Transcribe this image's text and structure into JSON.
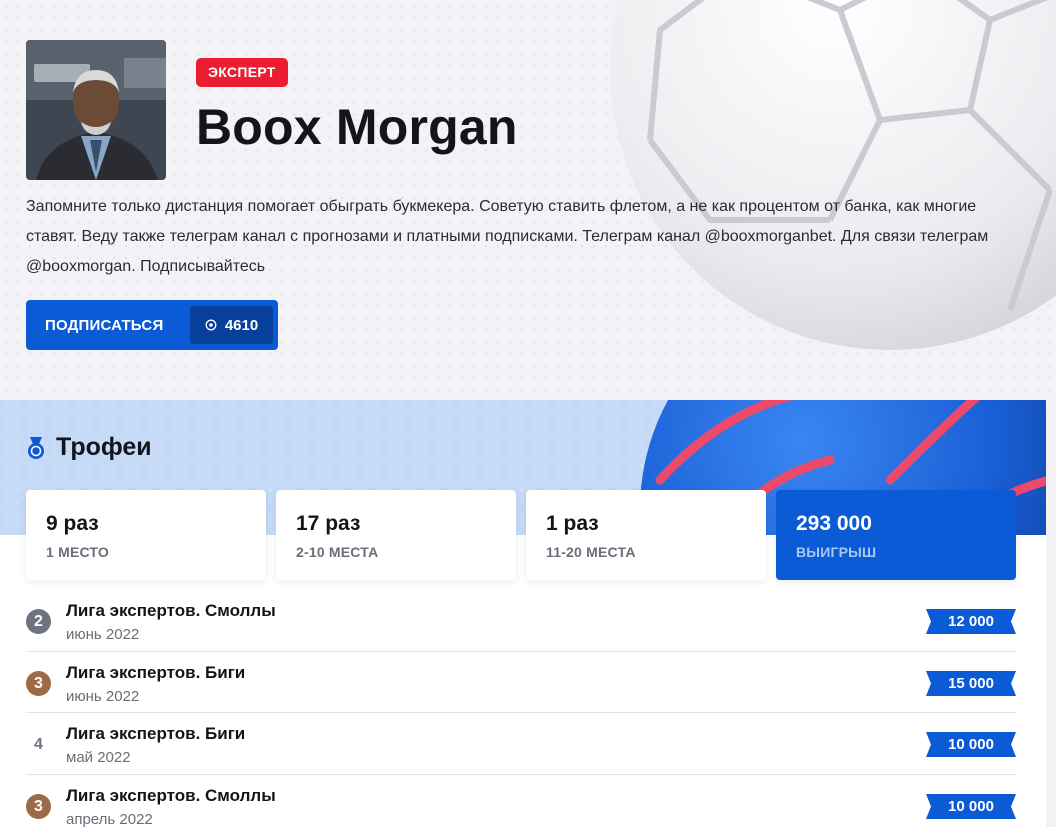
{
  "profile": {
    "badge": "ЭКСПЕРТ",
    "name": "Boox Morgan",
    "bio": "Запомните только дистанция помогает обыграть букмекера. Советую ставить флетом, а не как процентом от банка, как многие ставят. Веду также телеграм канал с прогнозами и платными подписками. Телеграм канал @booxmorganbet. Для связи телеграм @booxmorgan. Подписывайтесь",
    "subscribe_label": "ПОДПИСАТЬСЯ",
    "subscribers_count": "4610"
  },
  "trophies": {
    "title": "Трофеи",
    "stats": [
      {
        "value": "9 раз",
        "label": "1 МЕСТО"
      },
      {
        "value": "17 раз",
        "label": "2-10 МЕСТА"
      },
      {
        "value": "1 раз",
        "label": "11-20 МЕСТА"
      },
      {
        "value": "293 000",
        "label": "ВЫИГРЫШ"
      }
    ]
  },
  "results": [
    {
      "place": "2",
      "medal": "silver",
      "league": "Лига экспертов. Смоллы",
      "date": "июнь 2022",
      "prize": "12 000"
    },
    {
      "place": "3",
      "medal": "bronze",
      "league": "Лига экспертов. Биги",
      "date": "июнь 2022",
      "prize": "15 000"
    },
    {
      "place": "4",
      "medal": "none",
      "league": "Лига экспертов. Биги",
      "date": "май 2022",
      "prize": "10 000"
    },
    {
      "place": "3",
      "medal": "bronze",
      "league": "Лига экспертов. Смоллы",
      "date": "апрель 2022",
      "prize": "10 000"
    }
  ],
  "colors": {
    "accent_blue": "#0b5ad6",
    "badge_red": "#ec1d32",
    "silver": "#6f7282",
    "bronze": "#9c6a44"
  },
  "icons": {
    "trophy": "medal-icon",
    "subscribers": "target-icon"
  }
}
